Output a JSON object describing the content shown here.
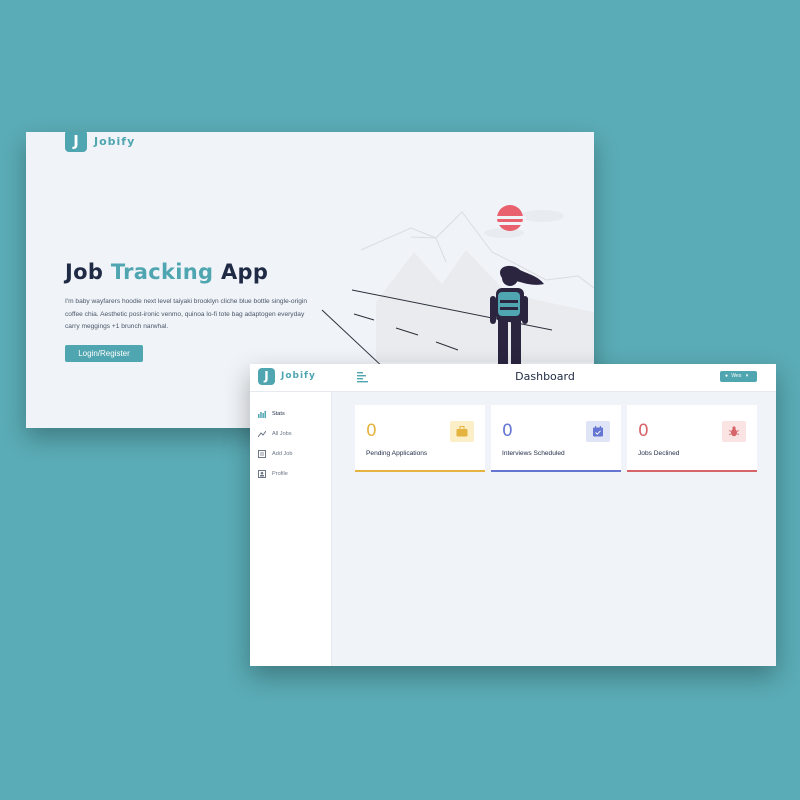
{
  "colors": {
    "background": "#5aacb6",
    "primary": "#4fa5b0",
    "heading": "#1f2a44",
    "pending": "#e5b33f",
    "interviews": "#6476d1",
    "declined": "#d6656a"
  },
  "landing": {
    "logo_letter": "J",
    "logo_name": "Jobify",
    "title_part1": "Job",
    "title_accent": "Tracking",
    "title_part2": "App",
    "description": "I'm baby wayfarers hoodie next level taiyaki brooklyn cliche blue bottle single-origin coffee chia. Aesthetic post-ironic venmo, quinoa lo-fi tote bag adaptogen everyday carry meggings +1 brunch narwhal.",
    "button_label": "Login/Register"
  },
  "dashboard": {
    "logo_letter": "J",
    "logo_name": "Jobify",
    "title": "Dashboard",
    "user_label": "Wes",
    "nav": [
      {
        "label": "Stats",
        "icon": "chart-icon",
        "active": true
      },
      {
        "label": "All Jobs",
        "icon": "trend-icon",
        "active": false
      },
      {
        "label": "Add Job",
        "icon": "form-icon",
        "active": false
      },
      {
        "label": "Profile",
        "icon": "profile-icon",
        "active": false
      }
    ],
    "cards": [
      {
        "count": "0",
        "title": "Pending Applications",
        "icon": "suitcase-icon"
      },
      {
        "count": "0",
        "title": "Interviews Scheduled",
        "icon": "calendar-check-icon"
      },
      {
        "count": "0",
        "title": "Jobs Declined",
        "icon": "bug-icon"
      }
    ]
  }
}
